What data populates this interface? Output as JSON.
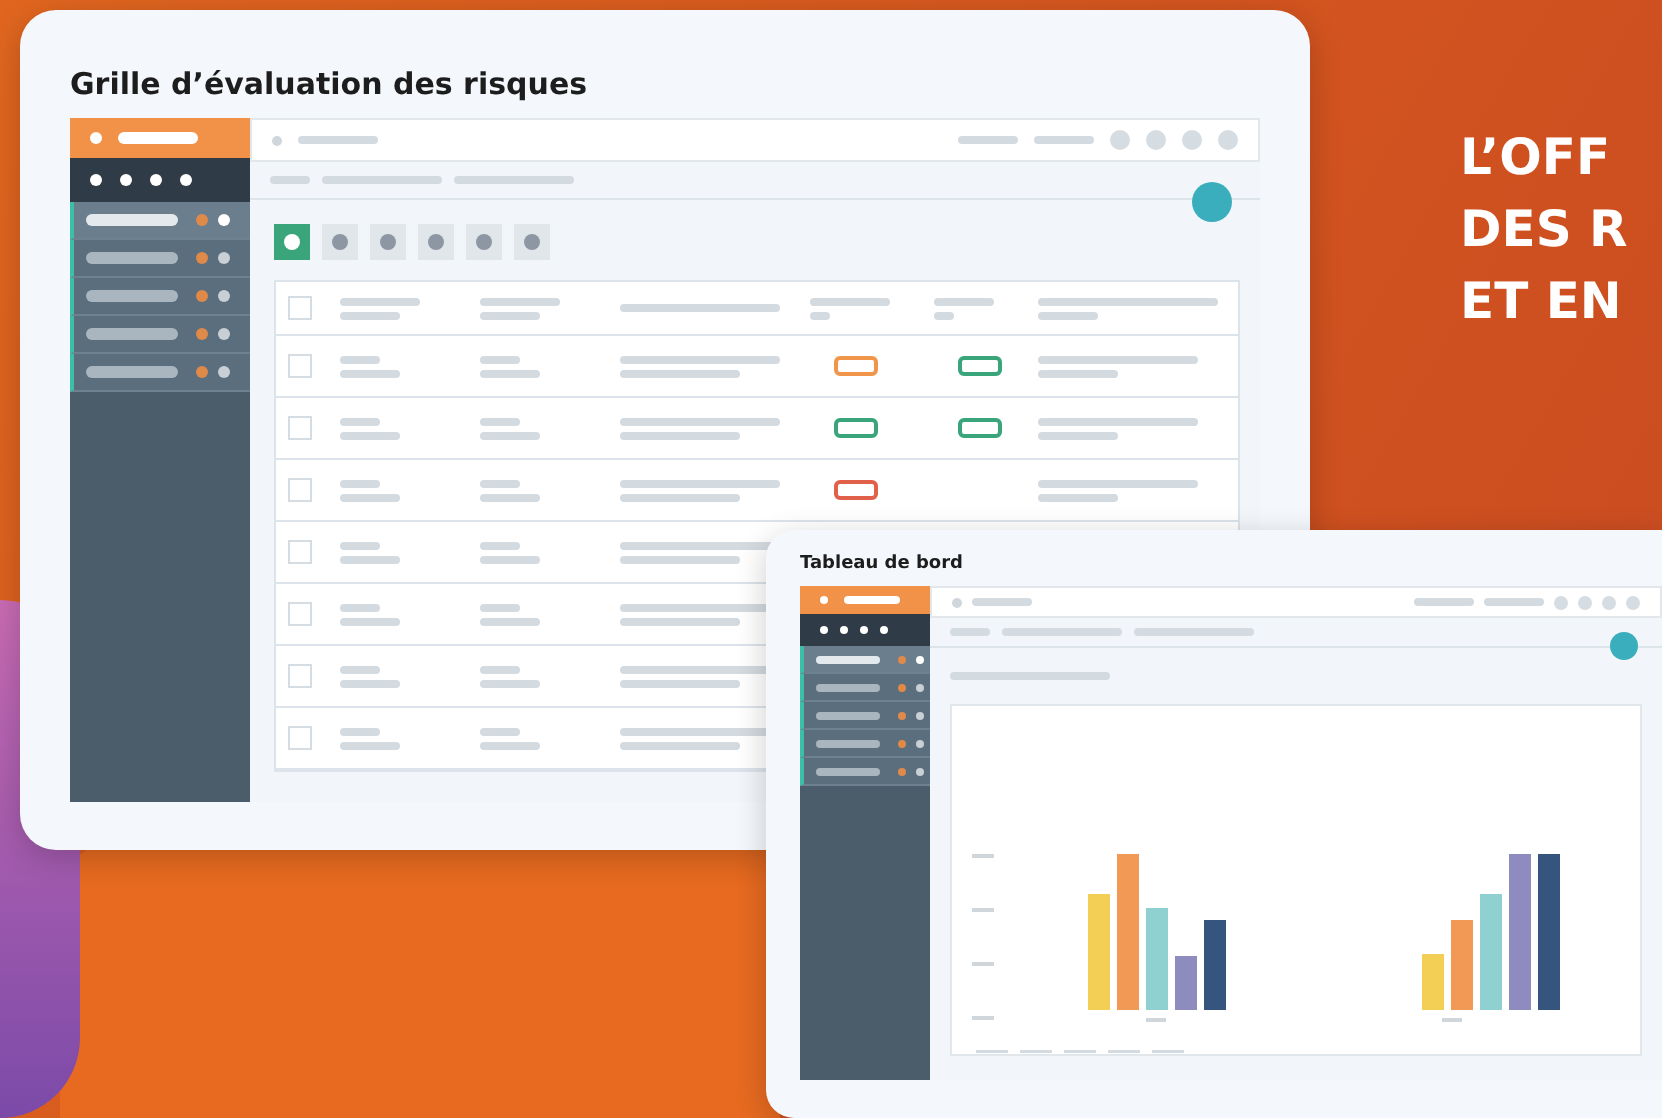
{
  "risk_window": {
    "title": "Grille d’évaluation des risques",
    "sidebar": {
      "items": [
        {
          "selected": true
        },
        {
          "selected": false
        },
        {
          "selected": false
        },
        {
          "selected": false
        },
        {
          "selected": false
        }
      ]
    },
    "tabs": [
      {
        "selected": true
      },
      {
        "selected": false
      },
      {
        "selected": false
      },
      {
        "selected": false
      },
      {
        "selected": false
      },
      {
        "selected": false
      }
    ],
    "table": {
      "select_all_checked": false,
      "rows": [
        {
          "checked": false,
          "tags": [
            {
              "color": "#f0954a"
            },
            {
              "color": "#3aa57a"
            }
          ]
        },
        {
          "checked": false,
          "tags": [
            {
              "color": "#3aa57a"
            },
            {
              "color": "#3aa57a"
            }
          ]
        },
        {
          "checked": false,
          "tags": [
            {
              "color": "#e0604a"
            }
          ]
        },
        {
          "checked": false
        },
        {
          "checked": false
        },
        {
          "checked": false
        },
        {
          "checked": false
        }
      ]
    }
  },
  "dashboard_window": {
    "title": "Tableau de bord",
    "sidebar": {
      "items": [
        {
          "selected": true
        },
        {
          "selected": false
        },
        {
          "selected": false
        },
        {
          "selected": false
        },
        {
          "selected": false
        }
      ]
    }
  },
  "headline": {
    "lines": [
      "L’OFF",
      "DES R",
      "ET EN"
    ]
  }
}
